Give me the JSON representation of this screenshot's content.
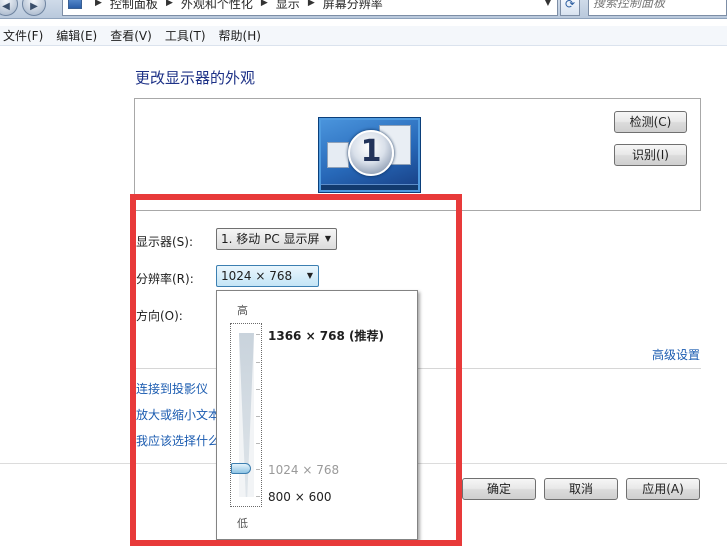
{
  "address_bar": {
    "breadcrumbs": [
      "控制面板",
      "外观和个性化",
      "显示",
      "屏幕分辨率"
    ],
    "search_placeholder": "搜索控制面板"
  },
  "menu": [
    "文件(F)",
    "编辑(E)",
    "查看(V)",
    "工具(T)",
    "帮助(H)"
  ],
  "main": {
    "title": "更改显示器的外观",
    "monitor_number": "1",
    "detect_button": "检测(C)",
    "identify_button": "识别(I)",
    "display_label": "显示器(S):",
    "display_value": "1. 移动 PC 显示屏",
    "resolution_label": "分辨率(R):",
    "resolution_value": "1024 × 768",
    "orientation_label": "方向(O):",
    "advanced_link": "高级设置",
    "links": [
      "连接到投影仪（",
      "放大或缩小文本",
      "我应该选择什么"
    ]
  },
  "dropdown": {
    "high_label": "高",
    "low_label": "低",
    "options": [
      {
        "label": "1366 × 768 (推荐)"
      },
      {
        "label": "1024 × 768"
      },
      {
        "label": "800 × 600"
      }
    ],
    "selected": "1024 × 768"
  },
  "footer": {
    "ok": "确定",
    "cancel": "取消",
    "apply": "应用(A)"
  },
  "colors": {
    "highlight": "#e83a3a",
    "link": "#1a5bb0",
    "title": "#1e3287"
  },
  "icons": [
    "back-arrow-icon",
    "forward-arrow-icon",
    "control-panel-icon",
    "chevron-right-icon",
    "refresh-icon",
    "dropdown-arrow-icon",
    "monitor-icon",
    "slider-thumb-icon"
  ]
}
